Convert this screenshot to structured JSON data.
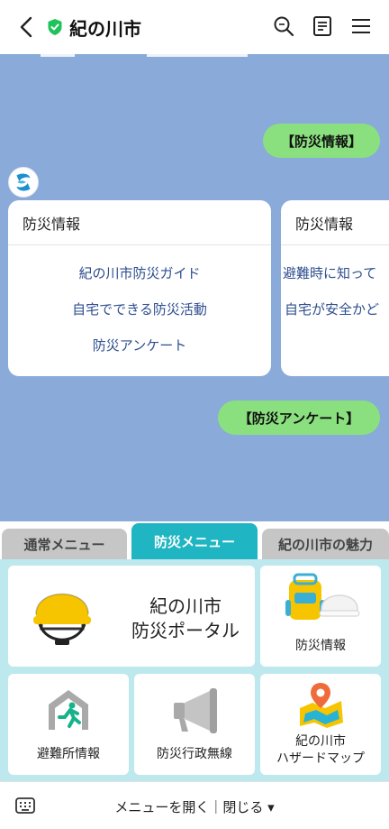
{
  "header": {
    "title": "紀の川市"
  },
  "chat": {
    "messages": [
      {
        "text": "【防災情報】"
      },
      {
        "text": "【防災アンケート】"
      }
    ],
    "cards": [
      {
        "title": "防災情報",
        "items": [
          "紀の川市防災ガイド",
          "自宅でできる防災活動",
          "防災アンケート"
        ]
      },
      {
        "title": "防災情報",
        "items": [
          "避難時に知って",
          "自宅が安全かど"
        ]
      }
    ]
  },
  "tabs": [
    {
      "label": "通常メニュー"
    },
    {
      "label": "防災メニュー"
    },
    {
      "label": "紀の川市の魅力"
    }
  ],
  "menu": {
    "portal_line1": "紀の川市",
    "portal_line2": "防災ポータル",
    "info": "防災情報",
    "shelter": "避難所情報",
    "radio": "防災行政無線",
    "hazard_line1": "紀の川市",
    "hazard_line2": "ハザードマップ"
  },
  "bottom": {
    "toggle_label": "メニューを開く｜閉じる ▾"
  },
  "colors": {
    "accent": "#1fb5c2",
    "chat_bg": "#8aaad9",
    "bubble": "#8ae07f",
    "panel_bg": "#bde8ee"
  }
}
